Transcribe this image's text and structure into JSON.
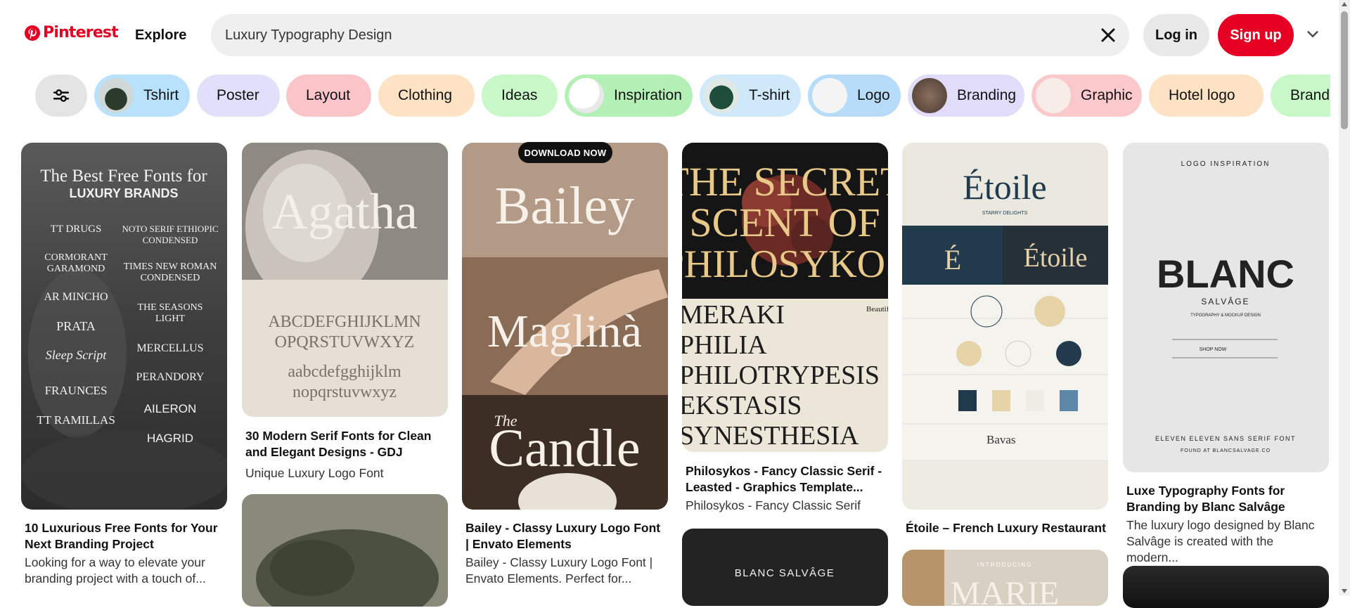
{
  "header": {
    "logo_text": "Pinterest",
    "explore_label": "Explore",
    "search_value": "Luxury Typography Design",
    "login_label": "Log in",
    "signup_label": "Sign up",
    "brand_color": "#e60023"
  },
  "chips": [
    {
      "label": "Tshirt",
      "bg": "#b8e2fb"
    },
    {
      "label": "Poster",
      "bg": "#e1e0fb"
    },
    {
      "label": "Layout",
      "bg": "#fbc4c8"
    },
    {
      "label": "Clothing",
      "bg": "#fde2c4"
    },
    {
      "label": "Ideas",
      "bg": "#c8f7c8"
    },
    {
      "label": "Inspiration",
      "bg": "#b3f0b6"
    },
    {
      "label": "T-shirt",
      "bg": "#cfe9fb"
    },
    {
      "label": "Logo",
      "bg": "#b6dcfa"
    },
    {
      "label": "Branding",
      "bg": "#e2dcfb"
    },
    {
      "label": "Graphic",
      "bg": "#fbc8cc"
    },
    {
      "label": "Hotel logo",
      "bg": "#fde2c4"
    },
    {
      "label": "Brandi",
      "bg": "#c8f7c8"
    }
  ],
  "pins": [
    {
      "title": "10 Luxurious Free Fonts for Your Next Branding Project",
      "description": "Looking for a way to elevate your branding project with a touch of...",
      "image_text": {
        "heading1": "The Best Free Fonts for",
        "heading2": "LUXURY BRANDS",
        "left": [
          "TT DRUGS",
          "CORMORANT",
          "GARAMOND",
          "AR MINCHO",
          "PRATA",
          "Sleep Script",
          "FRAUNCES",
          "TT RAMILLAS"
        ],
        "right": [
          "NOTO SERIF ETHIOPIC",
          "CONDENSED",
          "TIMES NEW ROMAN",
          "CONDENSED",
          "THE SEASONS",
          "LIGHT",
          "MERCELLUS",
          "PERANDORY",
          "AILERON",
          "HAGRID"
        ]
      }
    },
    {
      "title": "30 Modern Serif Fonts for Clean and Elegant Designs - GDJ",
      "description": "Unique Luxury Logo Font",
      "image_text": {
        "word": "Agatha",
        "upper1": "ABCDEFGHIJKLMN",
        "upper2": "OPQRSTUVWXYZ",
        "lower1": "aabcdefgghijklm",
        "lower2": "nopqrstuvwxyz"
      }
    },
    {
      "title": "Bailey - Classy Luxury Logo Font | Envato Elements",
      "description": "Bailey - Classy Luxury Logo Font | Envato Elements. Perfect for...",
      "badge": "DOWNLOAD NOW",
      "image_text": {
        "word1": "Bailey",
        "word2": "Maglinà",
        "word3": "Candle",
        "small": "The"
      }
    },
    {
      "title": "Philosykos - Fancy Classic Serif - Leasted - Graphics Template...",
      "description": "Philosykos - Fancy Classic Serif",
      "image_text": {
        "line1": "THE SECRET",
        "line2": "SCENT OF",
        "line3": "PHILOSYKOS",
        "words": [
          "MERAKI",
          "PHILIA",
          "PHILOTRYPESIS",
          "EKSTASIS",
          "SYNESTHESIA"
        ],
        "side": "Beautiful Green World"
      }
    },
    {
      "title": "Étoile – French Luxury Restaurant",
      "description": "",
      "image_text": {
        "word": "Étoile",
        "sub": "STARRY DELIGHTS",
        "mono": "É",
        "alt": "Bavas"
      }
    },
    {
      "title": "Luxe Typography Fonts for Branding by Blanc Salvâge",
      "description": "The luxury logo designed by Blanc Salvâge is created with the modern...",
      "image_text": {
        "top": "LOGO INSPIRATION",
        "word": "BLANC",
        "sub": "SALVÂGE",
        "tag": "TYPOGRAPHY & MOCKUP DESIGN",
        "shop": "SHOP NOW",
        "bottom": "ELEVEN ELEVEN SANS SERIF FONT",
        "found": "FOUND AT BLANCSALVAGE.CO"
      }
    },
    {
      "title": "",
      "image_text": {
        "word": "BLANC SALVÂGE"
      }
    },
    {
      "title": "",
      "image_text": {
        "intro": "INTRODUCING",
        "word": "MARIE"
      }
    }
  ]
}
